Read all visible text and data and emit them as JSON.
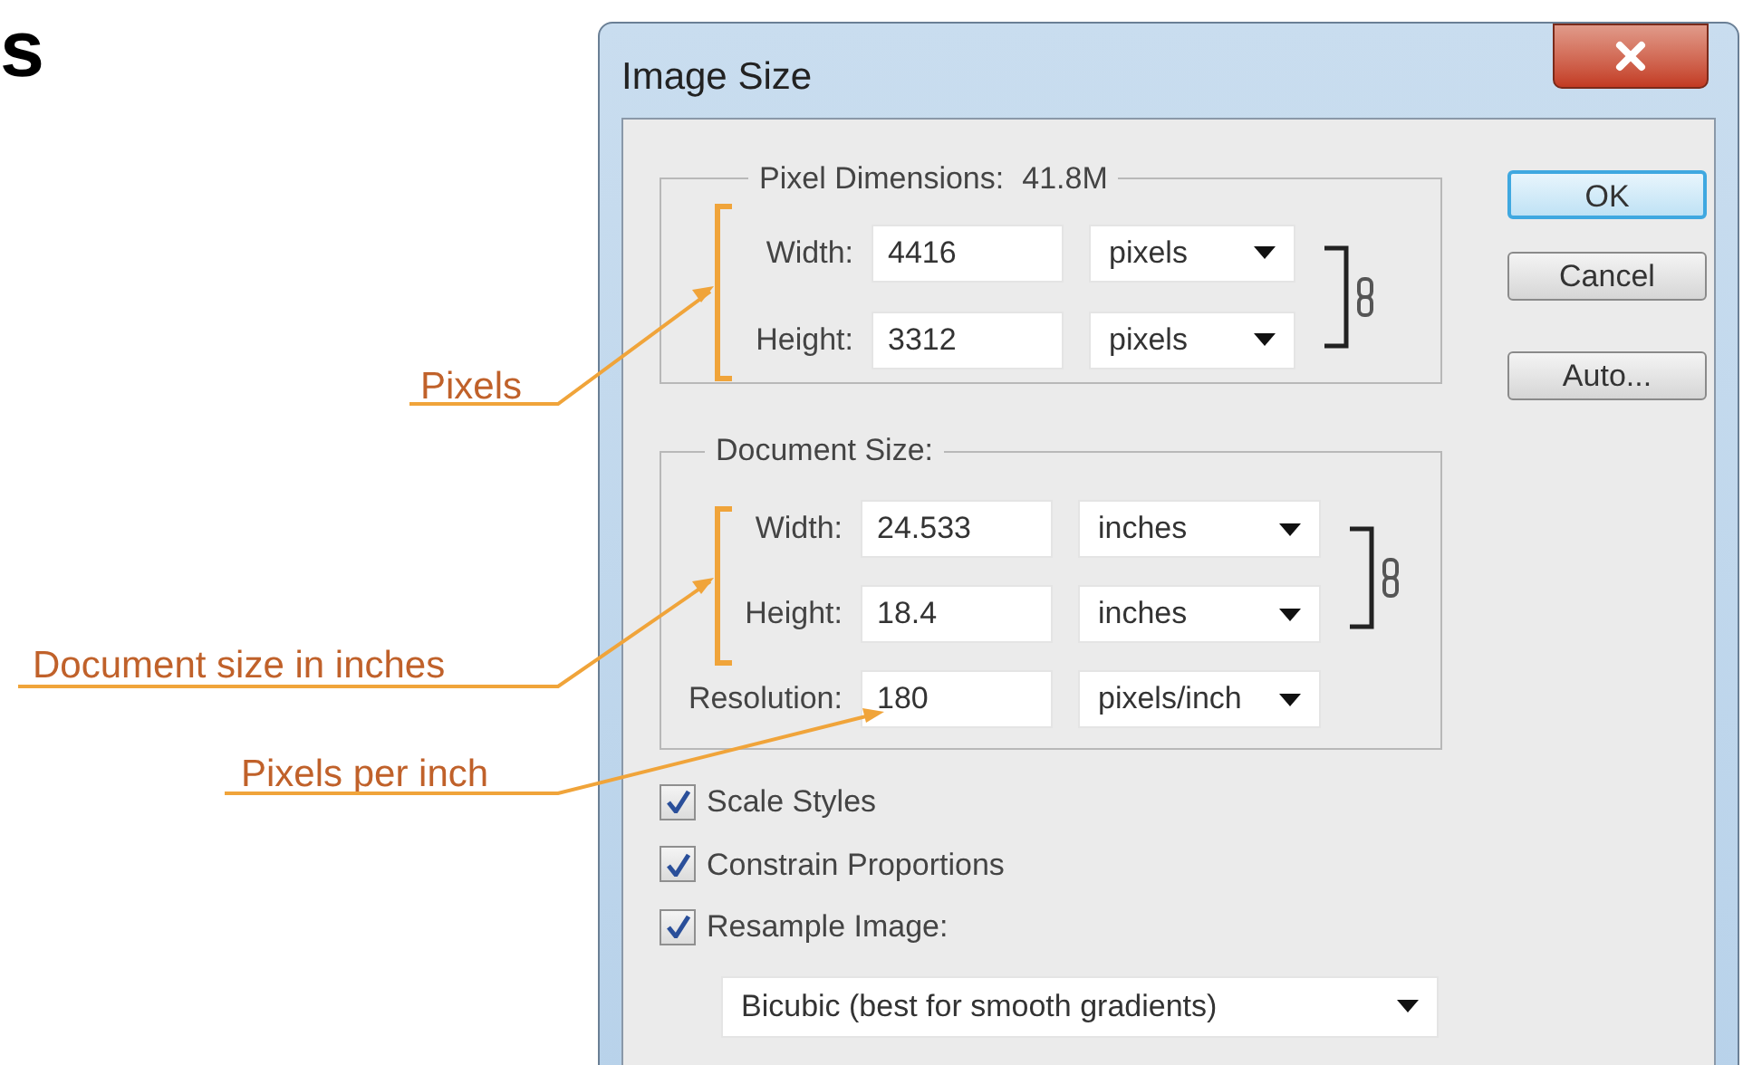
{
  "page_fragment": "s",
  "callouts": [
    {
      "text": "Pixels"
    },
    {
      "text": "Document size in inches"
    },
    {
      "text": "Pixels per inch"
    }
  ],
  "dialog": {
    "title": "Image Size",
    "pixel_dimensions": {
      "legend": "Pixel Dimensions:",
      "value": "41.8M",
      "rows": [
        {
          "label": "Width:",
          "value": "4416",
          "unit": "pixels"
        },
        {
          "label": "Height:",
          "value": "3312",
          "unit": "pixels"
        }
      ]
    },
    "document_size": {
      "legend": "Document Size:",
      "rows": [
        {
          "label": "Width:",
          "value": "24.533",
          "unit": "inches"
        },
        {
          "label": "Height:",
          "value": "18.4",
          "unit": "inches"
        },
        {
          "label": "Resolution:",
          "value": "180",
          "unit": "pixels/inch"
        }
      ]
    },
    "buttons": [
      {
        "label": "OK",
        "default": true
      },
      {
        "label": "Cancel",
        "default": false
      },
      {
        "label": "Auto...",
        "default": false
      }
    ],
    "checkboxes": [
      {
        "label": "Scale Styles",
        "checked": true
      },
      {
        "label": "Constrain Proportions",
        "checked": true
      },
      {
        "label": "Resample Image:",
        "checked": true
      }
    ],
    "resample_method": "Bicubic (best for smooth gradients)"
  }
}
